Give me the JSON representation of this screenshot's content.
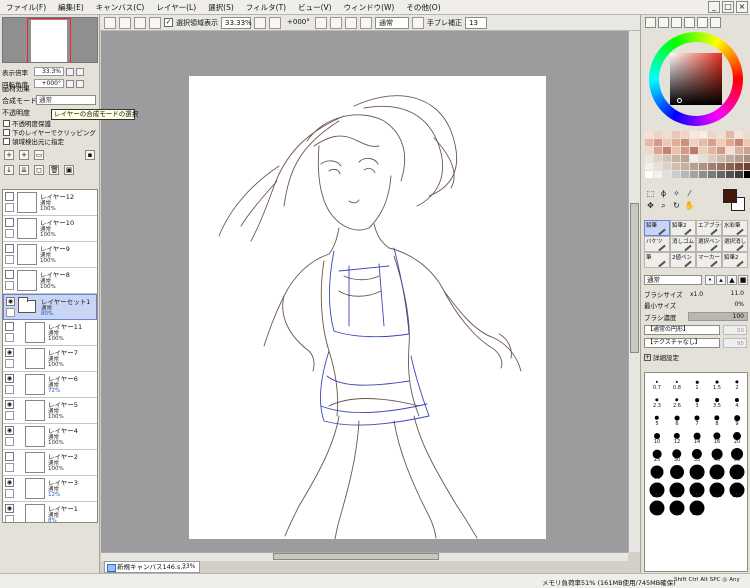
{
  "menu": [
    "ファイル(F)",
    "編集(E)",
    "キャンバス(C)",
    "レイヤー(L)",
    "選択(S)",
    "フィルタ(T)",
    "ビュー(V)",
    "ウィンドウ(W)",
    "その他(O)"
  ],
  "toolbar": {
    "selection_label": "選択領域表示",
    "zoom": "33.33%",
    "rotation": "+000°",
    "mode": "通常",
    "stabilizer_label": "手ブレ補正",
    "stabilizer_value": "13"
  },
  "navigator": {
    "zoom_label": "表示倍率",
    "zoom_value": "33.3%",
    "angle_label": "回転角度",
    "angle_value": "+000°"
  },
  "layer_panel": {
    "effects_title": "画材効果",
    "blend_label": "合成モード",
    "blend_value": "通常",
    "opacity_label": "不透明度",
    "tooltip": "レイヤーの合成モードの選択",
    "check1": "不透明度保護",
    "check2": "下のレイヤーでクリッピング",
    "check3": "領域検出元に指定"
  },
  "layers": [
    {
      "name": "レイヤー12",
      "mode": "通常",
      "opacity": "100%",
      "child": false,
      "selected": false,
      "folder": false,
      "visible": false,
      "blue": false
    },
    {
      "name": "レイヤー10",
      "mode": "通常",
      "opacity": "100%",
      "child": false,
      "selected": false,
      "folder": false,
      "visible": false,
      "blue": false
    },
    {
      "name": "レイヤー9",
      "mode": "通常",
      "opacity": "100%",
      "child": false,
      "selected": false,
      "folder": false,
      "visible": false,
      "blue": false
    },
    {
      "name": "レイヤー8",
      "mode": "通常",
      "opacity": "100%",
      "child": false,
      "selected": false,
      "folder": false,
      "visible": false,
      "blue": false
    },
    {
      "name": "レイヤーセット1",
      "mode": "通常",
      "opacity": "80%",
      "child": false,
      "selected": true,
      "folder": true,
      "visible": true,
      "blue": true
    },
    {
      "name": "レイヤー11",
      "mode": "通常",
      "opacity": "100%",
      "child": true,
      "selected": false,
      "folder": false,
      "visible": false,
      "blue": false
    },
    {
      "name": "レイヤー7",
      "mode": "通常",
      "opacity": "100%",
      "child": true,
      "selected": false,
      "folder": false,
      "visible": true,
      "blue": false
    },
    {
      "name": "レイヤー6",
      "mode": "通常",
      "opacity": "72%",
      "child": true,
      "selected": false,
      "folder": false,
      "visible": true,
      "blue": true
    },
    {
      "name": "レイヤー5",
      "mode": "通常",
      "opacity": "100%",
      "child": true,
      "selected": false,
      "folder": false,
      "visible": true,
      "blue": false
    },
    {
      "name": "レイヤー4",
      "mode": "通常",
      "opacity": "100%",
      "child": true,
      "selected": false,
      "folder": false,
      "visible": true,
      "blue": false
    },
    {
      "name": "レイヤー2",
      "mode": "通常",
      "opacity": "100%",
      "child": true,
      "selected": false,
      "folder": false,
      "visible": false,
      "blue": false
    },
    {
      "name": "レイヤー3",
      "mode": "通常",
      "opacity": "12%",
      "child": true,
      "selected": false,
      "folder": false,
      "visible": true,
      "blue": true
    },
    {
      "name": "レイヤー1",
      "mode": "通常",
      "opacity": "8%",
      "child": true,
      "selected": false,
      "folder": false,
      "visible": true,
      "blue": true
    }
  ],
  "swatch_colors": [
    "#f6e0d8",
    "#eed2c6",
    "#f4dccc",
    "#e9c7b5",
    "#f0d4c2",
    "#f8e8de",
    "#fbeee6",
    "#ead6cc",
    "#f4ddd0",
    "#e2b8a4",
    "#f6e4da",
    "#efd9cf",
    "#e8b9a7",
    "#d99b87",
    "#f1c7b3",
    "#e3ad96",
    "#d08f7a",
    "#f0d0c0",
    "#e6bca8",
    "#d8a08a",
    "#f2cab6",
    "#e0a890",
    "#c98670",
    "#efc6b2",
    "#f3d7c9",
    "#dba593",
    "#c7836f",
    "#eac0ac",
    "#d49a85",
    "#bd7a66",
    "#f0cdbd",
    "#e5b39f",
    "#d19883",
    "#f6dfd3",
    "#ddb09d",
    "#caa190",
    "#efe6e0",
    "#e2d3ca",
    "#d6c2b6",
    "#c9b3a7",
    "#bca496",
    "#f4ece6",
    "#e8dcd4",
    "#dcccc2",
    "#cfbcb0",
    "#c2ada0",
    "#b59e91",
    "#a88f82",
    "#f7efea",
    "#ecdfd7",
    "#e0cfc4",
    "#d3bfb2",
    "#c7afa1",
    "#ba9f90",
    "#ae8f80",
    "#a27f70",
    "#967060",
    "#8a6050",
    "#7e5040",
    "#724030",
    "#ffffff",
    "#f2f2f2",
    "#e0e0e0",
    "#cccccc",
    "#b8b8b8",
    "#a3a3a3",
    "#8f8f8f",
    "#7a7a7a",
    "#666666",
    "#525252",
    "#3d3d3d",
    "#000000"
  ],
  "fg_color": "#44190d",
  "brushes": [
    "鉛筆",
    "鉛筆2",
    "エアブラシ",
    "水彩筆",
    "バケツ",
    "消しゴム",
    "選択ペン",
    "選択消し",
    "筆",
    "2値ペン",
    "マーカー",
    "鉛筆2"
  ],
  "tool_settings": {
    "mode": "通常",
    "size_label": "ブラシサイズ",
    "size_mult": "x1.0",
    "size_value": "11.0",
    "min_label": "最小サイズ",
    "min_value": "0%",
    "density_label": "ブラシ濃度",
    "density_value": "100",
    "shape": "【通常の円形】",
    "shape_num": "50",
    "texture": "【テクスチャなし】",
    "texture_num": "95",
    "detail": "詳細設定"
  },
  "sizes": [
    "0.7",
    "0.8",
    "1",
    "1.5",
    "2",
    "2.3",
    "2.6",
    "3",
    "3.5",
    "4",
    "5",
    "6",
    "7",
    "8",
    "9",
    "10",
    "12",
    "14",
    "16",
    "20",
    "25",
    "30",
    "35",
    "40",
    "50",
    "60",
    "70",
    "80",
    "100",
    "120",
    "160",
    "200",
    "250",
    "300",
    "350",
    "400",
    "450",
    "500"
  ],
  "status": {
    "task_title": "新規キャンバス146.s...",
    "task_zoom": "33%",
    "memory": "メモリ負荷率51% (161MB使用/745MB確保)",
    "keys": [
      "Shift",
      "Ctrl",
      "Alt",
      "SPC",
      "◎",
      "Any"
    ]
  }
}
